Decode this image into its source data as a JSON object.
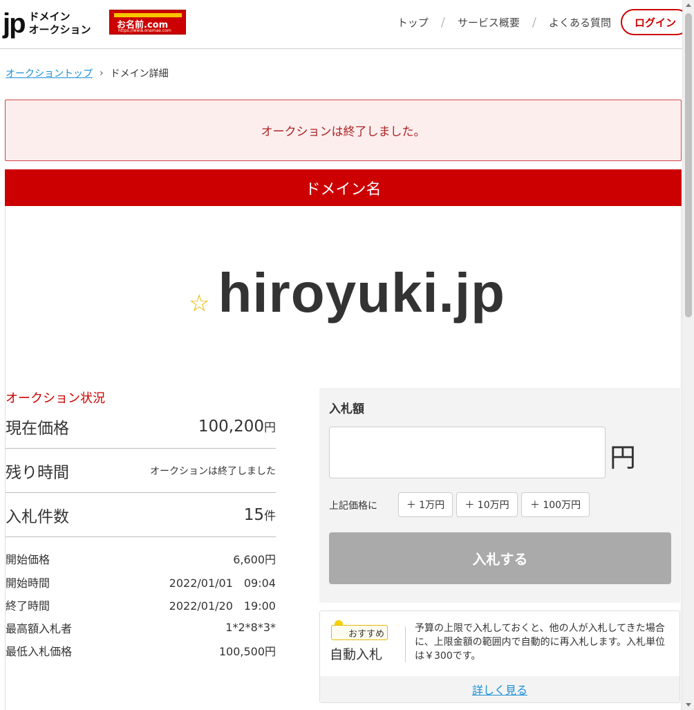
{
  "header": {
    "logo_jp": "jp",
    "logo_line1": "ドメイン",
    "logo_line2": "オークション",
    "partner_brand": "お名前.com",
    "partner_url": "https://www.onamae.com",
    "nav": [
      "トップ",
      "サービス概要",
      "よくある質問"
    ],
    "login": "ログイン"
  },
  "breadcrumb": {
    "link": "オークショントップ",
    "current": "ドメイン詳細"
  },
  "alert": "オークションは終了しました。",
  "domain_header": "ドメイン名",
  "domain": {
    "star": "☆",
    "name": "hiroyuki.jp"
  },
  "status": {
    "title": "オークション状況",
    "current_price_label": "現在価格",
    "current_price": "100,200",
    "current_price_unit": "円",
    "remaining_label": "残り時間",
    "remaining": "オークションは終了しました",
    "bids_label": "入札件数",
    "bids": "15",
    "bids_unit": "件",
    "details": [
      {
        "label": "開始価格",
        "value": "6,600円"
      },
      {
        "label": "開始時間",
        "value": "2022/01/01　09:04"
      },
      {
        "label": "終了時間",
        "value": "2022/01/20　19:00"
      },
      {
        "label": "最高額入札者",
        "value": "1*2*8*3*"
      },
      {
        "label": "最低入札価格",
        "value": "100,500円"
      }
    ]
  },
  "bid": {
    "label": "入札額",
    "input_value": "",
    "yen": "円",
    "above_label": "上記価格に",
    "increments": [
      "＋ 1万円",
      "＋ 10万円",
      "＋ 100万円"
    ],
    "submit": "入札する"
  },
  "auto_bid": {
    "badge": "おすすめ",
    "title": "自動入札",
    "desc": "予算の上限で入札しておくと、他の人が入札してきた場合に、上限金額の範囲内で自動的に再入札します。入札単位は￥300です。",
    "more": "詳しく見る"
  },
  "colors": {
    "accent": "#cc0000",
    "link": "#1a8fd6",
    "alert_bg": "#fdeeee",
    "disabled_button": "#aaaaaa"
  },
  "icons": [
    "star-icon",
    "chevron-right-icon",
    "lightbulb-icon"
  ]
}
